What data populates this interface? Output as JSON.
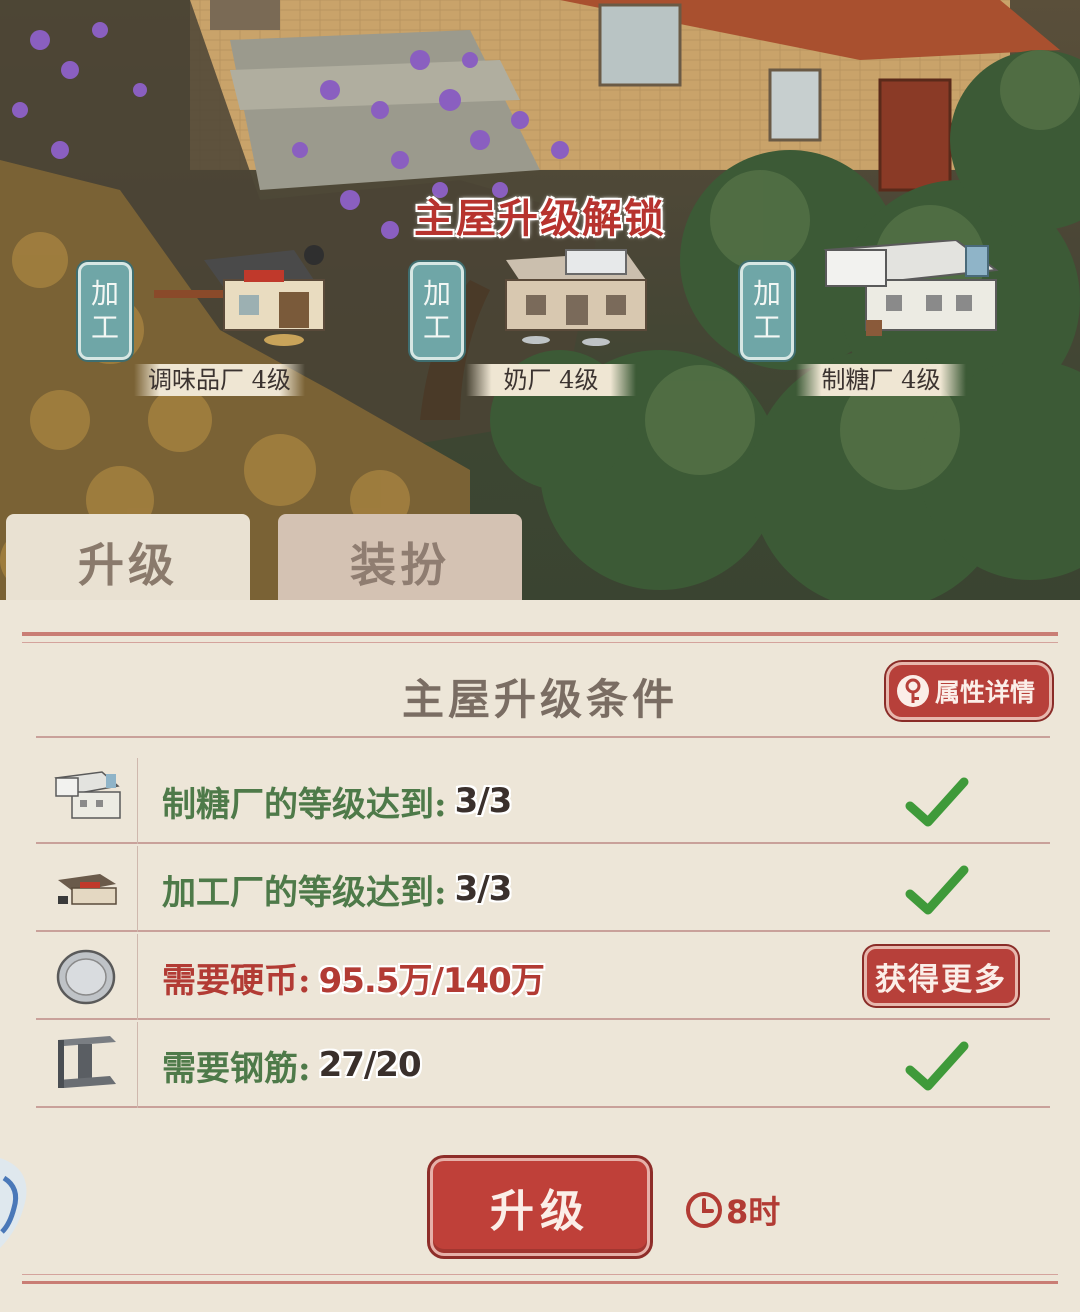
{
  "scene": {
    "unlock_title": "主屋升级解锁",
    "factories": [
      {
        "tag_line1": "加",
        "tag_line2": "工",
        "label": "调味品厂 4级",
        "icon": "seasoning-factory-icon"
      },
      {
        "tag_line1": "加",
        "tag_line2": "工",
        "label": "奶厂 4级",
        "icon": "dairy-factory-icon"
      },
      {
        "tag_line1": "加",
        "tag_line2": "工",
        "label": "制糖厂 4级",
        "icon": "sugar-factory-icon"
      }
    ]
  },
  "tabs": {
    "upgrade": "升级",
    "dress": "装扮"
  },
  "panel": {
    "title": "主屋升级条件",
    "details_button": "属性详情",
    "rows": [
      {
        "label": "制糖厂的等级达到:",
        "value": "3/3",
        "icon": "sugar-factory-icon",
        "status": "met"
      },
      {
        "label": "加工厂的等级达到:",
        "value": "3/3",
        "icon": "processing-factory-icon",
        "status": "met"
      },
      {
        "label": "需要硬币:",
        "value": "95.5万/140万",
        "icon": "coin-icon",
        "status": "insufficient",
        "action": "获得更多"
      },
      {
        "label": "需要钢筋:",
        "value": "27/20",
        "icon": "steel-beam-icon",
        "status": "met"
      }
    ],
    "upgrade_button": "升级",
    "timer": "8时"
  },
  "colors": {
    "accent_red": "#b7403a",
    "label_green": "#4e7a49",
    "tag_teal": "#6fa6a7",
    "panel_bg": "#ede6d8"
  }
}
